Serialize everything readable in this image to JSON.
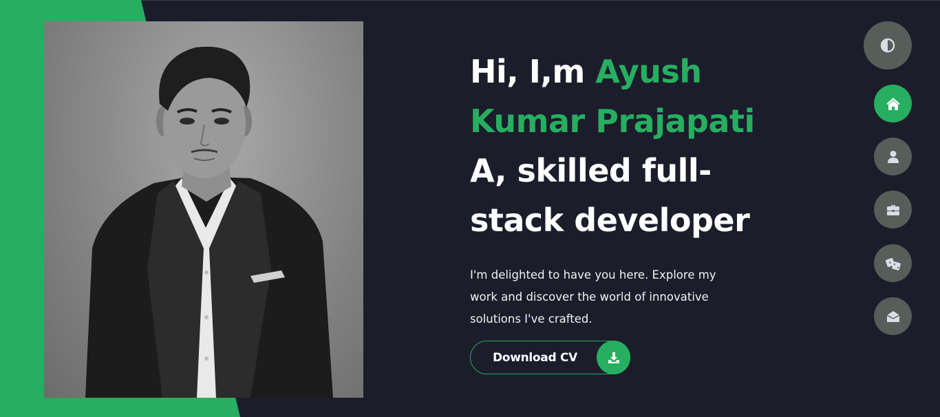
{
  "hero": {
    "greeting": "Hi, I,m",
    "name": "Ayush Kumar Prajapati",
    "tagline": "A, skilled full-stack developer",
    "intro": "I'm delighted to have you here. Explore my work and discover the world of innovative solutions I've crafted.",
    "cta_label": "Download CV"
  },
  "photo": {
    "subject": "portrait-photo",
    "style": "black-and-white"
  },
  "nav": {
    "theme_toggle_icon": "contrast-icon",
    "items": [
      {
        "icon": "home-icon",
        "active": true
      },
      {
        "icon": "user-icon",
        "active": false
      },
      {
        "icon": "briefcase-icon",
        "active": false
      },
      {
        "icon": "dice-icon",
        "active": false
      },
      {
        "icon": "envelope-open-icon",
        "active": false
      }
    ]
  },
  "colors": {
    "background": "#1b1d2b",
    "accent": "#27ae60",
    "nav_inactive": "#575d58",
    "text": "#ffffff",
    "icon_light": "#d8dde6"
  }
}
